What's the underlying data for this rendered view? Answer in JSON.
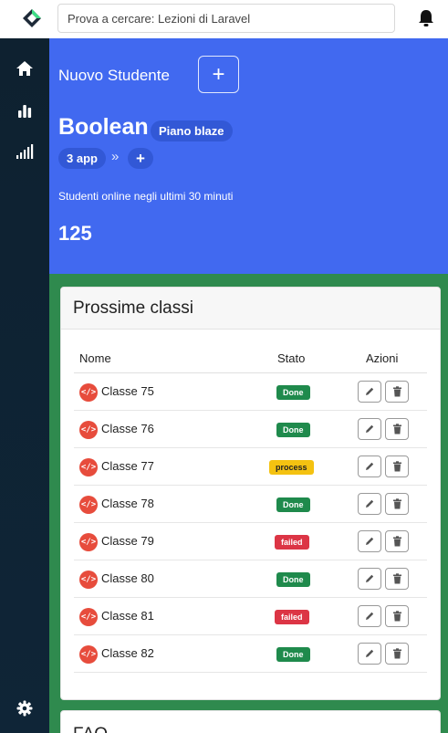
{
  "search": {
    "placeholder": "Prova a cercare: Lezioni di Laravel"
  },
  "sidebar": {
    "items": [
      "home-icon",
      "bar-chart-icon",
      "signal-icon",
      "gear-icon"
    ]
  },
  "hero": {
    "new_student_label": "Nuovo Studente",
    "add_label": "+",
    "company": "Boolean",
    "plan": "Piano blaze",
    "apps": "3 app",
    "chevron": "»",
    "plus": "+",
    "online_label": "Studenti online negli ultimi 30 minuti",
    "online_count": "125"
  },
  "card": {
    "title": "Prossime classi",
    "headers": {
      "name": "Nome",
      "state": "Stato",
      "actions": "Azioni"
    },
    "rows": [
      {
        "name": "Classe 75",
        "status": "Done"
      },
      {
        "name": "Classe 76",
        "status": "Done"
      },
      {
        "name": "Classe 77",
        "status": "process"
      },
      {
        "name": "Classe 78",
        "status": "Done"
      },
      {
        "name": "Classe 79",
        "status": "failed"
      },
      {
        "name": "Classe 80",
        "status": "Done"
      },
      {
        "name": "Classe 81",
        "status": "failed"
      },
      {
        "name": "Classe 82",
        "status": "Done"
      }
    ]
  },
  "faq": {
    "title": "FAQ"
  },
  "colors": {
    "hero": "#4169f0",
    "green": "#2f8a4e",
    "sidebar": "#0e2130",
    "done": "#1f8a4c",
    "failed": "#dc3545",
    "process": "#f4c211"
  }
}
